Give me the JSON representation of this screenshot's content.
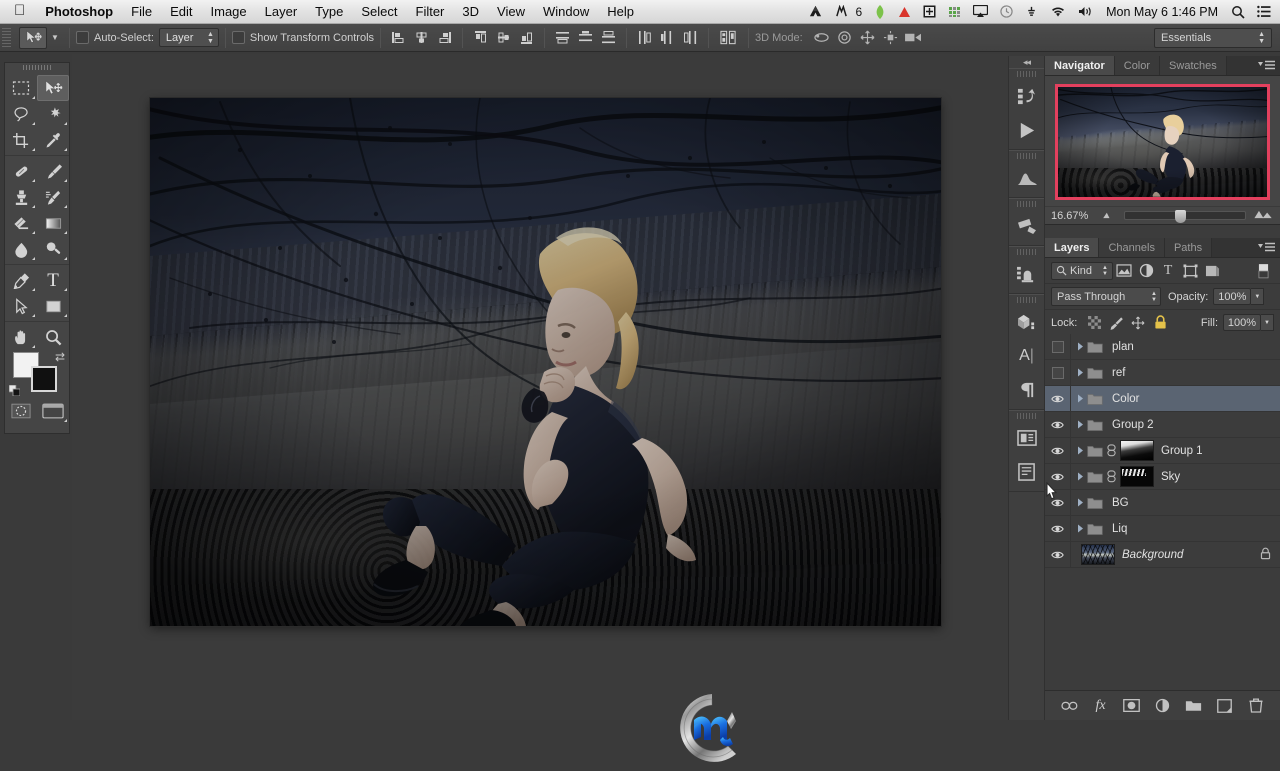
{
  "menubar": {
    "apple_glyph": "&#63743;",
    "app_name": "Photoshop",
    "items": [
      "File",
      "Edit",
      "Image",
      "Layer",
      "Type",
      "Select",
      "Filter",
      "3D",
      "View",
      "Window",
      "Help"
    ],
    "status_icons": [
      "drive-icon",
      "levels-meter-icon",
      "leaf-icon",
      "triangle-icon",
      "screen-icon",
      "equalizer-icon",
      "airplay-icon",
      "clock-icon",
      "keyboard-icon",
      "wifi-icon",
      "volume-icon"
    ],
    "dropbox_badge": "6",
    "clock": "Mon May 6  1:46 PM",
    "spotlight": "search-icon",
    "notifications": "list-icon"
  },
  "options_bar": {
    "tool": "move-tool",
    "auto_select_label": "Auto-Select:",
    "auto_select_checked": false,
    "auto_select_value": "Layer",
    "show_transform_label": "Show Transform Controls",
    "show_transform_checked": false,
    "align_buttons": [
      "align-left-edges",
      "align-horizontal-centers",
      "align-right-edges",
      "align-top-edges",
      "align-vertical-centers",
      "align-bottom-edges"
    ],
    "distribute_buttons": [
      "distribute-top-edges",
      "distribute-vertical-centers",
      "distribute-bottom-edges",
      "distribute-left-edges",
      "distribute-horizontal-centers",
      "distribute-right-edges"
    ],
    "auto_align_button": "auto-align-layers",
    "threed_mode_label": "3D Mode:",
    "threed_buttons": [
      "rotate-3d-object",
      "roll-3d-object",
      "drag-3d-object",
      "slide-3d-object",
      "scale-3d-object"
    ],
    "workspace": "Essentials"
  },
  "tools": {
    "groups": [
      [
        {
          "name": "rectangular-marquee-tool",
          "glyph": "marquee",
          "selected": false,
          "flyout": true
        },
        {
          "name": "move-tool",
          "glyph": "move",
          "selected": true,
          "flyout": false
        },
        {
          "name": "lasso-tool",
          "glyph": "lasso",
          "selected": false,
          "flyout": true
        },
        {
          "name": "quick-selection-tool",
          "glyph": "wand",
          "selected": false,
          "flyout": true
        },
        {
          "name": "crop-tool",
          "glyph": "crop",
          "selected": false,
          "flyout": true
        },
        {
          "name": "eyedropper-tool",
          "glyph": "eyedropper",
          "selected": false,
          "flyout": true
        }
      ],
      [
        {
          "name": "spot-healing-brush-tool",
          "glyph": "healing",
          "selected": false,
          "flyout": true
        },
        {
          "name": "brush-tool",
          "glyph": "brush",
          "selected": false,
          "flyout": true
        },
        {
          "name": "clone-stamp-tool",
          "glyph": "stamp",
          "selected": false,
          "flyout": true
        },
        {
          "name": "history-brush-tool",
          "glyph": "history-brush",
          "selected": false,
          "flyout": true
        },
        {
          "name": "eraser-tool",
          "glyph": "eraser",
          "selected": false,
          "flyout": true
        },
        {
          "name": "gradient-tool",
          "glyph": "gradient",
          "selected": false,
          "flyout": true
        },
        {
          "name": "blur-tool",
          "glyph": "blur",
          "selected": false,
          "flyout": true
        },
        {
          "name": "dodge-tool",
          "glyph": "dodge",
          "selected": false,
          "flyout": true
        }
      ],
      [
        {
          "name": "pen-tool",
          "glyph": "pen",
          "selected": false,
          "flyout": true
        },
        {
          "name": "horizontal-type-tool",
          "glyph": "type",
          "selected": false,
          "flyout": true
        },
        {
          "name": "path-selection-tool",
          "glyph": "path-select",
          "selected": false,
          "flyout": true
        },
        {
          "name": "rectangle-tool",
          "glyph": "rectangle",
          "selected": false,
          "flyout": true
        }
      ],
      [
        {
          "name": "hand-tool",
          "glyph": "hand",
          "selected": false,
          "flyout": true
        },
        {
          "name": "zoom-tool",
          "glyph": "zoom",
          "selected": false,
          "flyout": false
        }
      ]
    ],
    "foreground_color": "#f2f2f2",
    "background_color": "#101010",
    "swap_icon": "swap-colors-icon",
    "default_colors_icon": "default-colors-icon",
    "quick_mask_icon": "quick-mask-icon",
    "screen_mode_icon": "screen-mode-icon"
  },
  "icon_dock": {
    "collapse": "collapse-panels-icon",
    "groups": [
      [
        "history-icon",
        "actions-play-icon"
      ],
      [
        "histogram-icon"
      ],
      [
        "adjustments-icon"
      ],
      [
        "styles-icon"
      ],
      [
        "3d-icon",
        "character-icon",
        "paragraph-icon"
      ],
      [
        "notes-icon",
        "info-icon"
      ]
    ]
  },
  "navigator": {
    "tabs": [
      {
        "label": "Navigator",
        "active": true
      },
      {
        "label": "Color",
        "active": false
      },
      {
        "label": "Swatches",
        "active": false
      }
    ],
    "menu_icon": "panel-menu-icon",
    "zoom_level": "16.67%",
    "view_box_color": "#e3405e",
    "zoom_out_icon": "zoom-out-mountains-icon",
    "zoom_in_icon": "zoom-in-mountains-icon",
    "slider_position_pct": 42
  },
  "layers_panel": {
    "tabs": [
      {
        "label": "Layers",
        "active": true
      },
      {
        "label": "Channels",
        "active": false
      },
      {
        "label": "Paths",
        "active": false
      }
    ],
    "menu_icon": "panel-menu-icon",
    "filter_label": "Kind",
    "filter_icons": [
      "filter-pixel-icon",
      "filter-adjustment-icon",
      "filter-type-icon",
      "filter-shape-icon",
      "filter-smart-object-icon"
    ],
    "filter_toggle_icon": "filter-enable-toggle",
    "blend_mode": "Pass Through",
    "opacity_label": "Opacity:",
    "opacity_value": "100%",
    "lock_label": "Lock:",
    "lock_icons": [
      "lock-transparent-pixels-icon",
      "lock-image-pixels-icon",
      "lock-position-icon",
      "lock-all-icon"
    ],
    "lock_all_active": true,
    "fill_label": "Fill:",
    "fill_value": "100%",
    "layers": [
      {
        "name": "plan",
        "type": "group",
        "visible": false,
        "selected": false,
        "has_mask": false,
        "locked": false
      },
      {
        "name": "ref",
        "type": "group",
        "visible": false,
        "selected": false,
        "has_mask": false,
        "locked": false
      },
      {
        "name": "Color",
        "type": "group",
        "visible": true,
        "selected": true,
        "has_mask": false,
        "locked": false
      },
      {
        "name": "Group 2",
        "type": "group",
        "visible": true,
        "selected": false,
        "has_mask": false,
        "locked": false
      },
      {
        "name": "Group 1",
        "type": "group",
        "visible": true,
        "selected": false,
        "has_mask": true,
        "locked": false
      },
      {
        "name": "Sky",
        "type": "group",
        "visible": true,
        "selected": false,
        "has_mask": true,
        "locked": false
      },
      {
        "name": "BG",
        "type": "group",
        "visible": true,
        "selected": false,
        "has_mask": false,
        "locked": false
      },
      {
        "name": "Liq",
        "type": "group",
        "visible": true,
        "selected": false,
        "has_mask": false,
        "locked": false
      },
      {
        "name": "Background",
        "type": "image",
        "visible": true,
        "selected": false,
        "has_mask": false,
        "locked": true
      }
    ],
    "bottom_buttons": [
      "link-layers-icon",
      "layer-style-fx-icon",
      "add-layer-mask-icon",
      "new-adjustment-layer-icon",
      "new-group-icon",
      "new-layer-icon",
      "delete-layer-icon"
    ]
  },
  "document": {
    "zoom": "16.67%",
    "watermark": "cg-logo-watermark"
  }
}
